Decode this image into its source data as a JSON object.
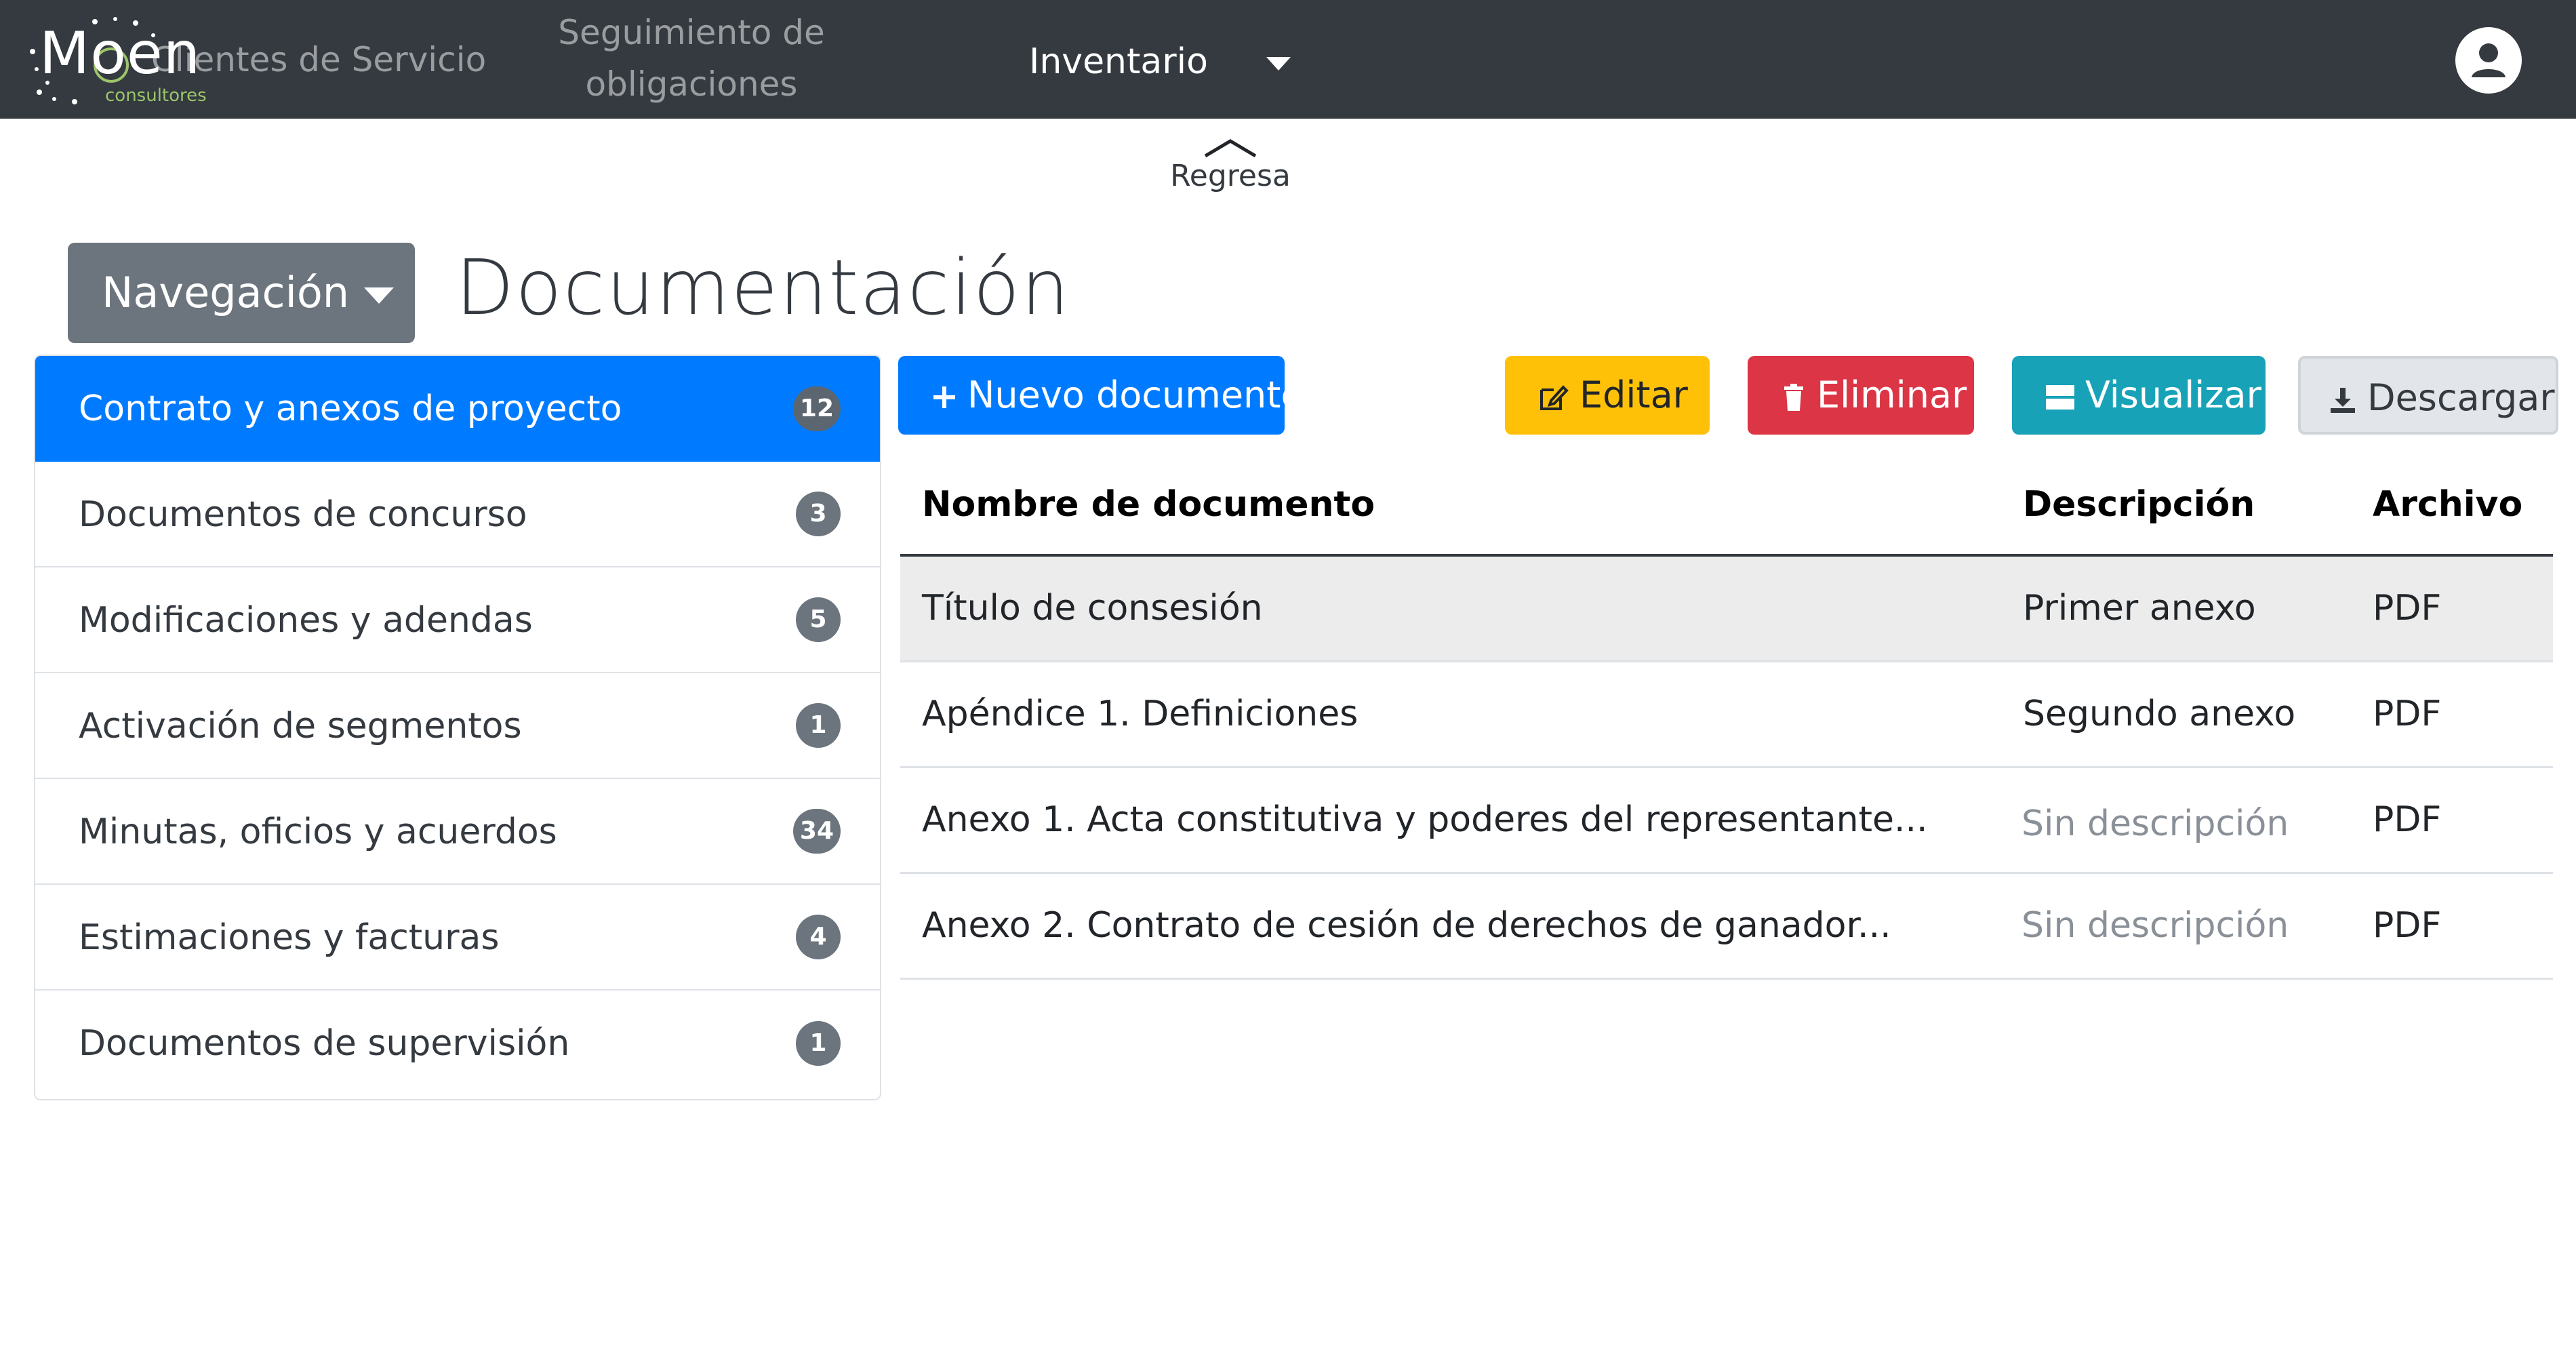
{
  "navbar": {
    "logo": {
      "text": "Moen",
      "subtitle": "consultores"
    },
    "links": [
      "Clientes de Servicio",
      "Seguimiento de obligaciones"
    ],
    "dropdown_label": "Inventario",
    "avatar_icon": "user-icon"
  },
  "regresa": {
    "label": "Regresa",
    "icon": "chevron-up-icon"
  },
  "nav_button": {
    "label": "Navegación"
  },
  "page_title": "Documentación",
  "sidebar": {
    "items": [
      {
        "label": "Contrato y anexos de proyecto",
        "count": "12",
        "active": true
      },
      {
        "label": "Documentos de concurso",
        "count": "3"
      },
      {
        "label": "Modificaciones y adendas",
        "count": "5"
      },
      {
        "label": "Activación de segmentos",
        "count": "1"
      },
      {
        "label": "Minutas, oficios y acuerdos",
        "count": "34"
      },
      {
        "label": "Estimaciones y facturas",
        "count": "4"
      },
      {
        "label": "Documentos de supervisión",
        "count": "1"
      }
    ]
  },
  "toolbar": {
    "new_label": "Nuevo documento",
    "edit_label": "Editar",
    "delete_label": "Eliminar",
    "view_label": "Visualizar",
    "download_label": "Descargar"
  },
  "table": {
    "headers": [
      "Nombre de documento",
      "Descripción",
      "Archivo"
    ],
    "rows": [
      {
        "name": "Título de consesión",
        "description": "Primer anexo",
        "file": "PDF",
        "selected": true
      },
      {
        "name": "Apéndice 1. Definiciones",
        "description": "Segundo anexo",
        "file": "PDF"
      },
      {
        "name": "Anexo 1. Acta constitutiva y poderes del representante...",
        "description": "Sin descripción",
        "file": "PDF"
      },
      {
        "name": "Anexo 2. Contrato de cesión de derechos de ganador...",
        "description": "Sin descripción",
        "file": "PDF"
      }
    ]
  },
  "colors": {
    "navbar": "#343a40",
    "primary": "#007bff",
    "warning": "#ffc107",
    "danger": "#dc3545",
    "info": "#17a2b8",
    "secondary": "#6c757d"
  }
}
